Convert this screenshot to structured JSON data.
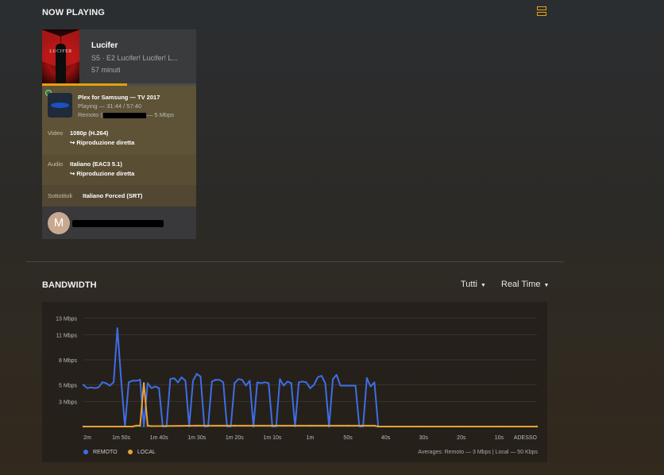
{
  "now_playing": {
    "title": "NOW PLAYING",
    "poster_text": "LUCIFER",
    "show_title": "Lucifer",
    "episode": "S5 · E2 Lucifer! Lucifer! L...",
    "duration": "57 minuti",
    "progress": 0.55,
    "device": {
      "name": "Plex for Samsung  —  TV 2017",
      "state": "Playing — 31:44 / 57:40",
      "remote_prefix": "Remoto (",
      "remote_suffix": "— 5 Mbps",
      "logo_text": "SAMSUNG"
    },
    "video": {
      "label": "Video",
      "value": "1080p (H.264)",
      "sub": "↪  Riproduzione diretta"
    },
    "audio": {
      "label": "Audio",
      "value": "Italiano (EAC3 5.1)",
      "sub": "↪  Riproduzione diretta"
    },
    "subtitles": {
      "label": "Sottotitoli",
      "value": "Italiano Forced (SRT)"
    },
    "user": {
      "initial": "M"
    }
  },
  "bandwidth": {
    "title": "BANDWIDTH",
    "filter_devices": "Tutti",
    "filter_range": "Real Time",
    "legend": [
      {
        "name": "REMOTO",
        "color": "#3d6ee6"
      },
      {
        "name": "LOCAL",
        "color": "#e5a33a"
      }
    ],
    "averages": "Averages: Remoto — 3 Mbps | Local — 50 Kbps"
  },
  "chart_data": {
    "type": "line",
    "y_ticks": [
      "13 Mbps",
      "11 Mbps",
      "8 Mbps",
      "5 Mbps",
      "3 Mbps"
    ],
    "y_tick_values": [
      13,
      11,
      8,
      5,
      3
    ],
    "ylim": [
      0,
      14
    ],
    "x_ticks": [
      "2m",
      "1m 50s",
      "1m 40s",
      "1m 30s",
      "1m 20s",
      "1m 10s",
      "1m",
      "50s",
      "40s",
      "30s",
      "20s",
      "10s",
      "ADESSO"
    ],
    "x_tick_seconds": [
      120,
      110,
      100,
      90,
      80,
      70,
      60,
      50,
      40,
      30,
      20,
      10,
      0
    ],
    "xlim": [
      120,
      0
    ],
    "series": [
      {
        "name": "REMOTO",
        "color": "#3d6ee6",
        "points": [
          [
            120,
            5.0
          ],
          [
            119,
            4.6
          ],
          [
            118,
            4.7
          ],
          [
            117,
            4.6
          ],
          [
            116,
            4.7
          ],
          [
            115,
            5.3
          ],
          [
            114,
            5.2
          ],
          [
            113,
            4.9
          ],
          [
            112,
            5.3
          ],
          [
            111,
            11.8
          ],
          [
            110,
            5.5
          ],
          [
            109,
            0
          ],
          [
            108,
            5.3
          ],
          [
            107,
            5.5
          ],
          [
            106,
            5.5
          ],
          [
            105,
            5.6
          ],
          [
            104,
            0
          ],
          [
            103,
            5.2
          ],
          [
            102,
            4.6
          ],
          [
            101,
            4.8
          ],
          [
            100,
            4.6
          ],
          [
            99,
            0
          ],
          [
            98,
            0
          ],
          [
            97,
            5.7
          ],
          [
            96,
            5.8
          ],
          [
            95,
            5.3
          ],
          [
            94,
            5.9
          ],
          [
            93,
            5.5
          ],
          [
            92,
            0
          ],
          [
            91,
            5.5
          ],
          [
            90,
            6.3
          ],
          [
            89,
            6.0
          ],
          [
            88,
            0
          ],
          [
            87,
            0
          ],
          [
            86,
            5.4
          ],
          [
            85,
            5.6
          ],
          [
            84,
            5.6
          ],
          [
            83,
            5.3
          ],
          [
            82,
            0
          ],
          [
            81,
            0
          ],
          [
            80,
            5.2
          ],
          [
            79,
            5.7
          ],
          [
            78,
            5.6
          ],
          [
            77,
            4.9
          ],
          [
            76,
            5.5
          ],
          [
            75,
            0
          ],
          [
            74,
            5.3
          ],
          [
            73,
            5.2
          ],
          [
            72,
            5.3
          ],
          [
            71,
            5.2
          ],
          [
            70,
            0
          ],
          [
            69,
            0
          ],
          [
            68,
            5.7
          ],
          [
            67,
            4.9
          ],
          [
            66,
            5.4
          ],
          [
            65,
            5.2
          ],
          [
            64,
            0
          ],
          [
            63,
            5.3
          ],
          [
            62,
            5.4
          ],
          [
            61,
            5.3
          ],
          [
            60,
            4.6
          ],
          [
            59,
            5.0
          ],
          [
            58,
            5.9
          ],
          [
            57,
            6.1
          ],
          [
            56,
            5.2
          ],
          [
            55,
            0
          ],
          [
            54,
            5.7
          ],
          [
            53,
            6.2
          ],
          [
            52,
            4.9
          ],
          [
            51,
            4.9
          ],
          [
            50,
            4.9
          ],
          [
            49,
            4.9
          ],
          [
            48,
            4.9
          ],
          [
            47,
            0
          ],
          [
            46,
            0
          ],
          [
            45,
            5.8
          ],
          [
            44,
            4.8
          ],
          [
            43,
            5.3
          ],
          [
            42,
            0
          ],
          [
            41,
            0
          ],
          [
            40,
            0
          ],
          [
            30,
            0
          ],
          [
            20,
            0
          ],
          [
            10,
            0
          ],
          [
            0,
            0
          ]
        ]
      },
      {
        "name": "LOCAL",
        "color": "#e5a33a",
        "points": [
          [
            120,
            0
          ],
          [
            107,
            0
          ],
          [
            106,
            0.1
          ],
          [
            105,
            0.1
          ],
          [
            104,
            5.2
          ],
          [
            103,
            0.1
          ],
          [
            102,
            0.05
          ],
          [
            90,
            0.1
          ],
          [
            80,
            0.1
          ],
          [
            70,
            0.1
          ],
          [
            60,
            0.1
          ],
          [
            50,
            0.1
          ],
          [
            43,
            0.1
          ],
          [
            42,
            0
          ],
          [
            0,
            0
          ]
        ]
      }
    ],
    "grid": true,
    "legend_position": "bottom-left"
  }
}
